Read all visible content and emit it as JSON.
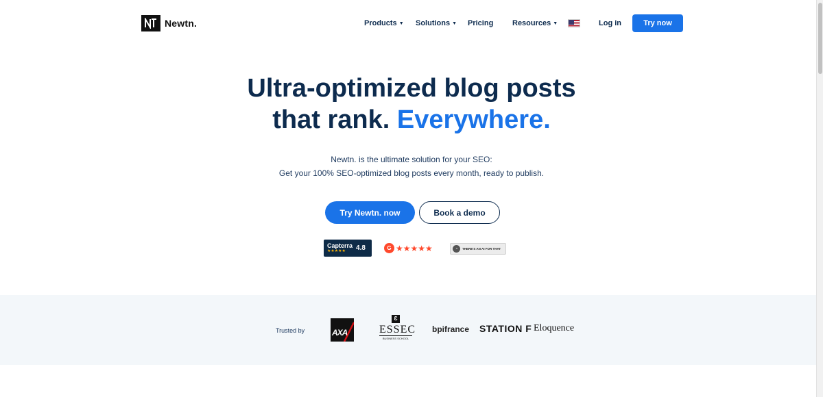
{
  "nav": {
    "brand": "Newtn.",
    "menu": [
      {
        "label": "Products",
        "has_dropdown": true
      },
      {
        "label": "Solutions",
        "has_dropdown": true
      },
      {
        "label": "Pricing",
        "has_dropdown": false
      },
      {
        "label": "Resources",
        "has_dropdown": true
      }
    ],
    "language_icon": "us-flag-icon",
    "login_label": "Log in",
    "cta_label": "Try now"
  },
  "hero": {
    "title_line1": "Ultra-optimized blog posts",
    "title_line2_plain": "that rank.",
    "title_line2_accent": "Everywhere.",
    "subtitle_line1": "Newtn. is the ultimate solution for your SEO:",
    "subtitle_line2": "Get your 100% SEO-optimized blog posts every month, ready to publish.",
    "primary_button": "Try Newtn. now",
    "secondary_button": "Book a demo"
  },
  "badges": {
    "capterra": {
      "name": "Capterra",
      "stars": "★★★★★",
      "score": "4.8"
    },
    "g2": {
      "logo": "G",
      "stars": "★★★★★"
    },
    "taaft": {
      "text": "THERE'S AN AI FOR THAT"
    }
  },
  "trusted": {
    "label": "Trusted by",
    "logos": {
      "axa": "AXA",
      "essec": "ESSEC",
      "essec_sub": "BUSINESS SCHOOL",
      "bpifrance": "bpifrance",
      "stationf": "STATION F",
      "eloquence": "Eloquence"
    }
  },
  "colors": {
    "primary": "#1a73e8",
    "heading": "#0d2b4e",
    "band_bg": "#f3f7fa"
  }
}
